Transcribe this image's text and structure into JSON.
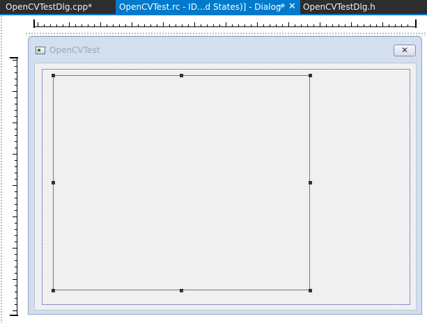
{
  "tabs": [
    {
      "label": "OpenCVTestDlg.cpp*",
      "active": false
    },
    {
      "label": "OpenCVTest.rc - ID...d States)] - Dialog*",
      "active": true
    },
    {
      "label": "OpenCVTestDlg.h",
      "active": false
    }
  ],
  "tab_controls": {
    "pin_icon": "pin-icon",
    "close_icon": "close-icon",
    "pin_glyph": "⊣",
    "close_glyph": "✕"
  },
  "dialog": {
    "title": "OpenCVTest",
    "icon": "app-window-icon",
    "close_glyph": "✕"
  },
  "colors": {
    "tab_bar": "#2d2d30",
    "active_tab": "#007acc",
    "dialog_frame": "#d3dfee",
    "client_area": "#f0f0f0",
    "guide_line": "#2b2bb0"
  }
}
